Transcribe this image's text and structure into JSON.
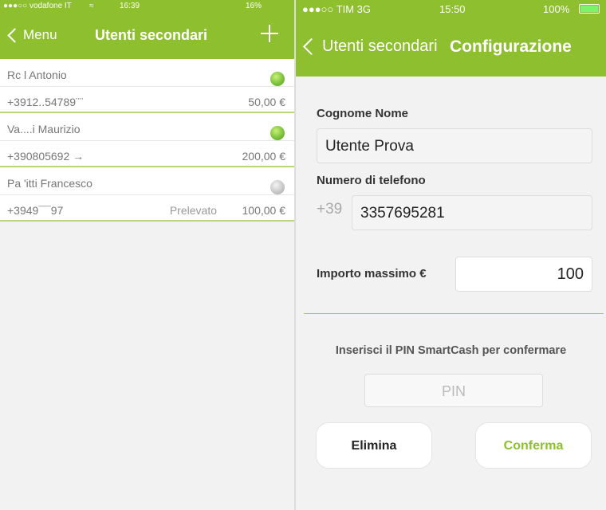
{
  "left_screen": {
    "status_bar": {
      "carrier": "●●●○○ vodafone IT",
      "wifi": "≈",
      "time": "16:39",
      "battery": "16%"
    },
    "nav": {
      "back_label": "Menu",
      "title": "Utenti secondari",
      "add_icon": "plus-icon"
    },
    "users": [
      {
        "name": "Rc    l Antonio",
        "phone": "+3912..54789¨¨",
        "status": "",
        "amount": "50,00 €",
        "active": true
      },
      {
        "name": "Va....i Maurizio",
        "phone": "+390805692    →",
        "status": "",
        "amount": "200,00 €",
        "active": true
      },
      {
        "name": "Pa    'itti Francesco",
        "phone": "+3949¯¯97",
        "status": "Prelevato",
        "amount": "100,00 €",
        "active": false
      }
    ]
  },
  "right_screen": {
    "status_bar": {
      "carrier": "●●●○○ TIM  3G",
      "time": "15:50",
      "battery": "100%"
    },
    "nav": {
      "back_label": "Utenti secondari",
      "title": "Configurazione"
    },
    "form": {
      "name_label": "Cognome Nome",
      "name_value": "Utente Prova",
      "phone_label": "Numero di telefono",
      "phone_prefix": "+39",
      "phone_value": "3357695281",
      "amount_label": "Importo massimo €",
      "amount_value": "100",
      "pin_prompt": "Inserisci il PIN SmartCash per confermare",
      "pin_placeholder": "PIN"
    },
    "buttons": {
      "delete": "Elimina",
      "confirm": "Conferma"
    }
  },
  "colors": {
    "accent": "#8dbf2e",
    "background": "#f2f2f2",
    "separator": "#b8d67a"
  }
}
